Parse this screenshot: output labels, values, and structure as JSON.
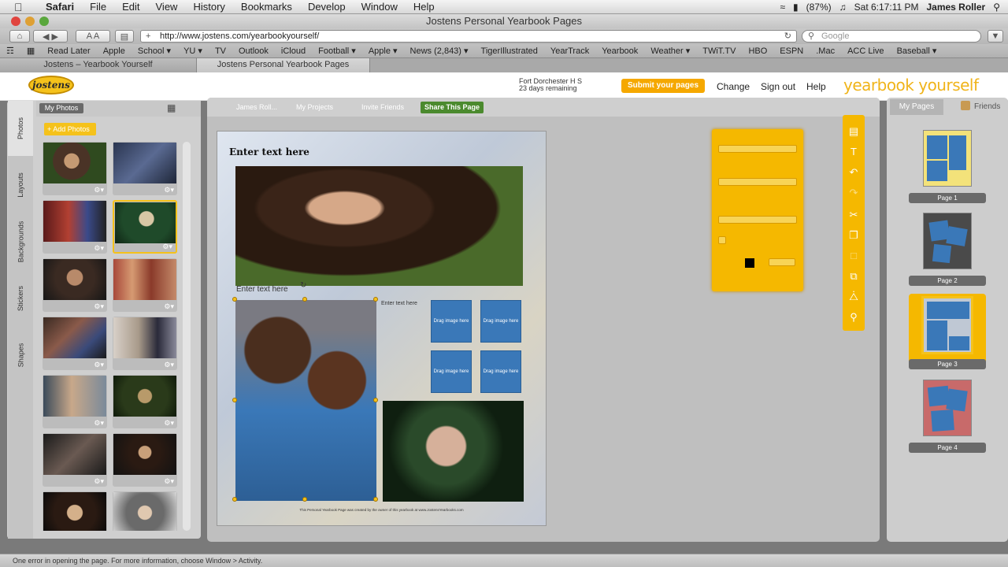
{
  "menubar": {
    "items": [
      "Safari",
      "File",
      "Edit",
      "View",
      "History",
      "Bookmarks",
      "Develop",
      "Window",
      "Help"
    ],
    "battery": "(87%)",
    "clock": "Sat 6:17:11 PM",
    "user": "James Roller"
  },
  "window": {
    "title": "Jostens Personal Yearbook Pages"
  },
  "toolbar": {
    "url": "http://www.jostens.com/yearbookyourself/",
    "search_placeholder": "Google"
  },
  "bookmarks": [
    "Read Later",
    "Apple",
    "School ▾",
    "YU ▾",
    "TV",
    "Outlook",
    "iCloud",
    "Football ▾",
    "Apple ▾",
    "News (2,843) ▾",
    "TigerIllustrated",
    "YearTrack",
    "Yearbook",
    "Weather ▾",
    "TWiT.TV",
    "HBO",
    "ESPN",
    ".Mac",
    "ACC Live",
    "Baseball ▾"
  ],
  "tabs": [
    {
      "label": "Jostens – Yearbook Yourself"
    },
    {
      "label": "Jostens Personal Yearbook Pages"
    }
  ],
  "header": {
    "logo_text": "jostens",
    "school": "Fort Dorchester H S",
    "days": "23 days remaining",
    "submit": "Submit your pages",
    "change": "Change",
    "signout": "Sign out",
    "help": "Help",
    "brand": "yearbook yourself"
  },
  "left": {
    "side_tabs": [
      "Photos",
      "Layouts",
      "Backgrounds",
      "Stickers",
      "Shapes"
    ],
    "my_photos": "My Photos",
    "add_photos": "+ Add Photos"
  },
  "editor": {
    "tabs": [
      "James Roll...",
      "My Projects",
      "Invite Friends"
    ],
    "share": "Share This Page",
    "headline": "Enter text here",
    "caption_1": "Enter text here",
    "caption_2": "Enter text here",
    "slot_label": "Drag image here",
    "footer": "This Personal Yearbook Page was created by the owner of this yearbook at www.JostensYearbooks.com"
  },
  "right": {
    "my_pages": "My Pages",
    "friends": "Friends",
    "pages": [
      "Page 1",
      "Page 2",
      "Page 3",
      "Page 4"
    ]
  },
  "status": "One error in opening the page. For more information, choose Window > Activity.",
  "colors": {
    "accent": "#f5b800",
    "share_green": "#4b8a2e",
    "slot_blue": "#3a78b8"
  }
}
